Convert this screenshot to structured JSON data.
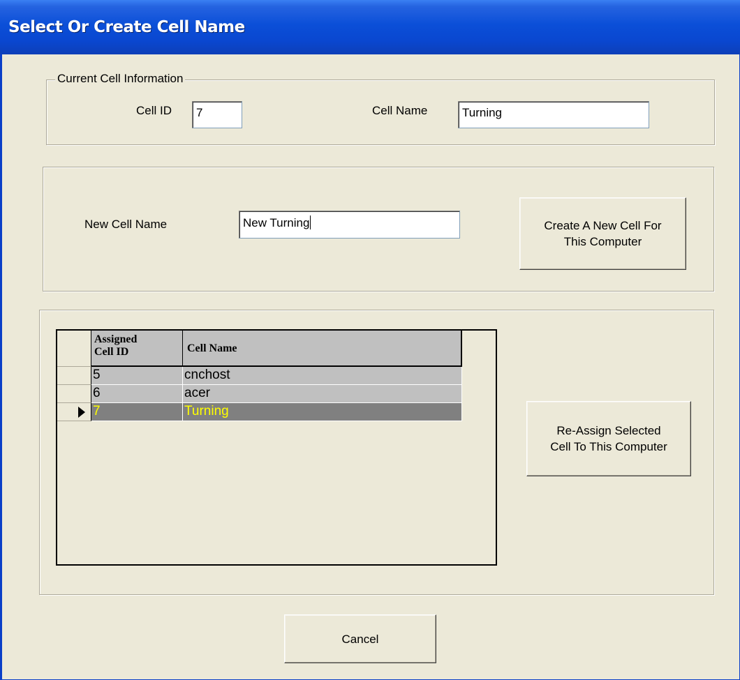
{
  "window": {
    "title": "Select Or Create Cell Name"
  },
  "current_cell": {
    "group_label": "Current Cell Information",
    "cell_id_label": "Cell ID",
    "cell_id_value": "7",
    "cell_name_label": "Cell Name",
    "cell_name_value": "Turning"
  },
  "new_cell": {
    "label": "New Cell Name",
    "value": "New Turning",
    "create_button_line1": "Create A New Cell For",
    "create_button_line2": "This Computer"
  },
  "assigned_grid": {
    "columns": [
      "Assigned Cell ID",
      "Cell Name"
    ],
    "column0_line1": "Assigned",
    "column0_line2": "Cell ID",
    "rows": [
      {
        "id": "5",
        "name": "cnchost",
        "selected": false
      },
      {
        "id": "6",
        "name": "acer",
        "selected": false
      },
      {
        "id": "7",
        "name": "Turning",
        "selected": true
      }
    ],
    "reassign_button_line1": "Re-Assign Selected",
    "reassign_button_line2": "Cell To This Computer"
  },
  "footer": {
    "cancel_label": "Cancel"
  },
  "colors": {
    "title_bar": "#0a47d0",
    "dialog_bg": "#ece9d8",
    "selected_row_bg": "#808080",
    "selected_row_text": "#ffff00",
    "grid_cell_bg": "#c0c0c0"
  },
  "icons": {
    "row_indicator": "current-row-arrow-icon"
  }
}
